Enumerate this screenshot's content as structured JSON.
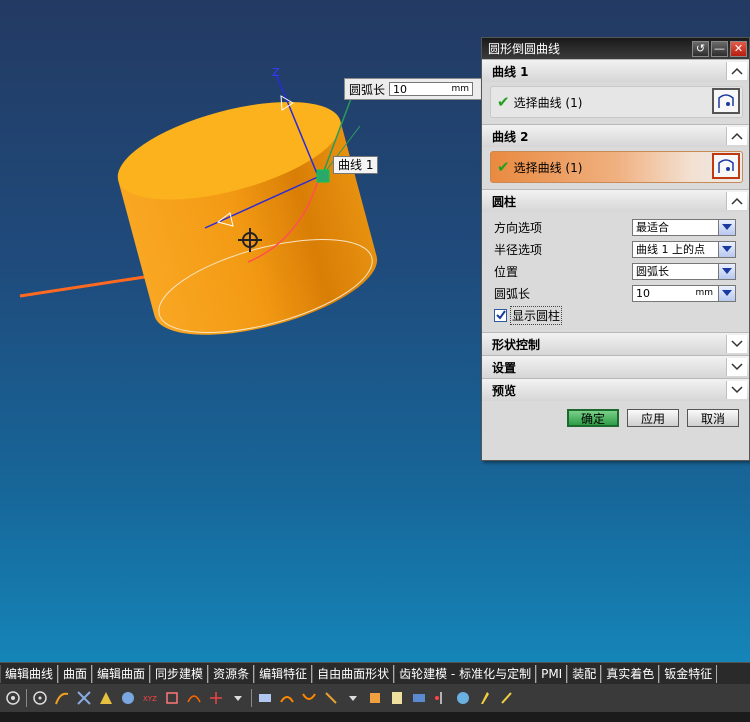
{
  "viewport": {
    "arc_popup": {
      "label": "圆弧长",
      "value": "10",
      "unit": "mm"
    },
    "curve_tag": "曲线 1",
    "axis_label": "Z"
  },
  "dialog": {
    "title": "圆形倒圆曲线",
    "titlebar_buttons": [
      "reset-icon",
      "minimize-icon",
      "close-icon"
    ],
    "curve1": {
      "header": "曲线 1",
      "select_label": "选择曲线 (1)"
    },
    "curve2": {
      "header": "曲线 2",
      "select_label": "选择曲线 (1)"
    },
    "cylinder": {
      "header": "圆柱",
      "direction_label": "方向选项",
      "direction_value": "最适合",
      "radius_label": "半径选项",
      "radius_value": "曲线 1 上的点",
      "position_label": "位置",
      "position_value": "圆弧长",
      "arc_label": "圆弧长",
      "arc_value": "10",
      "arc_unit": "mm",
      "show_cylinder_label": "显示圆柱",
      "show_cylinder_checked": true
    },
    "shape_control": "形状控制",
    "settings": "设置",
    "preview": "预览",
    "ok": "确定",
    "apply": "应用",
    "cancel": "取消"
  },
  "tabs": [
    "编辑曲线",
    "曲面",
    "编辑曲面",
    "同步建模",
    "资源条",
    "编辑特征",
    "自由曲面形状",
    "齿轮建模 - 标准化与定制",
    "PMI",
    "装配",
    "真实着色",
    "钣金特征"
  ],
  "colors": {
    "accent_orange": "#f39a1a",
    "check_green": "#21a021",
    "primary_button": "#2e9c46"
  }
}
